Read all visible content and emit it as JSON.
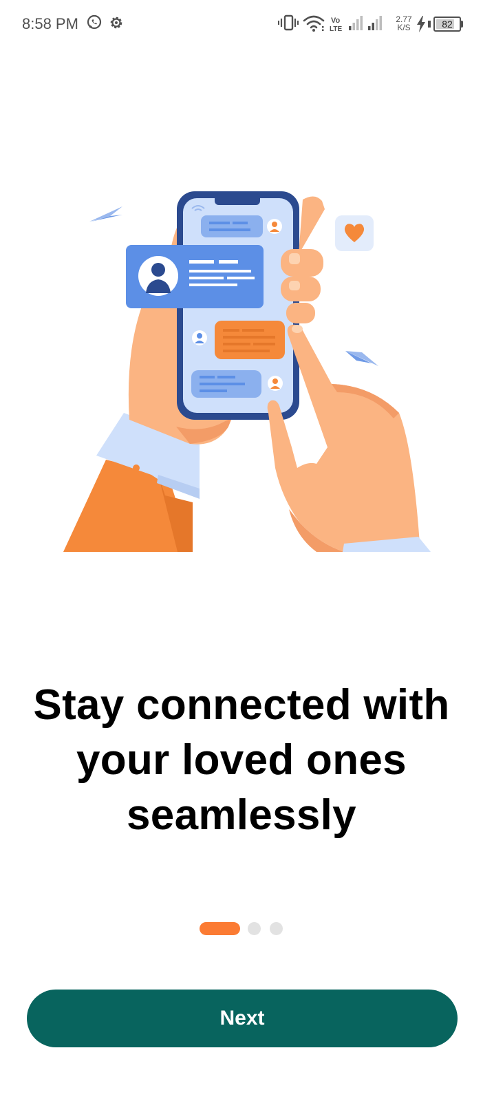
{
  "status_bar": {
    "time": "8:58 PM",
    "net_speed_value": "2.77",
    "net_speed_unit": "K/S",
    "battery_level": "82",
    "icons": [
      "whatsapp-icon",
      "settings-gear-icon",
      "vibrate-icon",
      "wifi-icon",
      "volte-icon",
      "signal-icon",
      "signal-icon",
      "charging-icon",
      "battery-icon"
    ]
  },
  "onboarding": {
    "illustration": "hands-holding-phone-chat-illustration",
    "headline": "Stay connected with your loved ones seamlessly",
    "pager": {
      "total": 3,
      "active_index": 0
    },
    "next_label": "Next"
  },
  "colors": {
    "accent": "#fb7b33",
    "button": "#08645e",
    "dot_inactive": "#e2e2e2",
    "phone_frame": "#2b4a8f",
    "chat_blue": "#5c8fe6",
    "chat_orange": "#f5893a"
  }
}
